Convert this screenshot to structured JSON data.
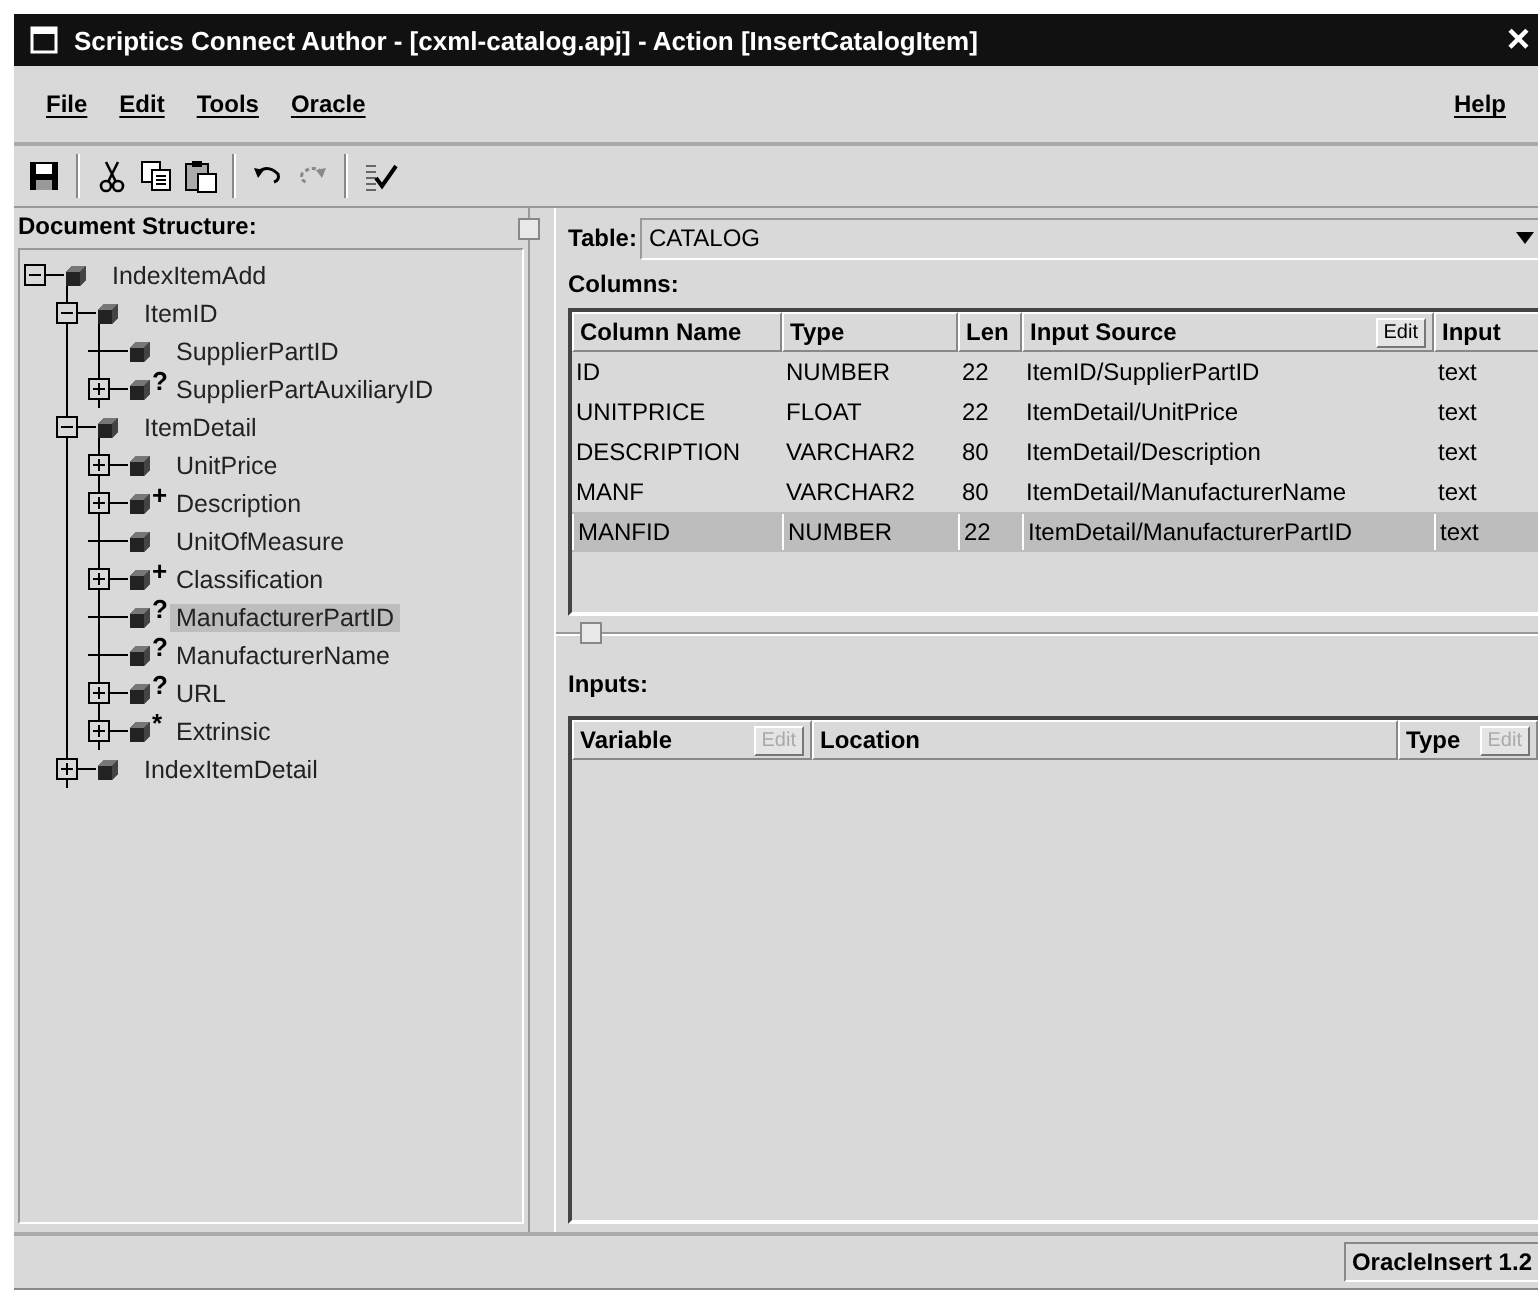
{
  "window": {
    "title": "Scriptics Connect Author - [cxml-catalog.apj] - Action [InsertCatalogItem]",
    "close": "×"
  },
  "menu": {
    "left": [
      "File",
      "Edit",
      "Tools",
      "Oracle"
    ],
    "right": [
      "Help"
    ]
  },
  "toolbar": [
    {
      "kind": "save",
      "disabled": false
    },
    {
      "kind": "sep"
    },
    {
      "kind": "cut",
      "disabled": false
    },
    {
      "kind": "copy",
      "disabled": false
    },
    {
      "kind": "paste",
      "disabled": false
    },
    {
      "kind": "sep"
    },
    {
      "kind": "undo",
      "disabled": false
    },
    {
      "kind": "redo",
      "disabled": true
    },
    {
      "kind": "sep"
    },
    {
      "kind": "check",
      "disabled": false
    }
  ],
  "document_structure": {
    "title": "Document Structure:",
    "tree": [
      {
        "label": "IndexItemAdd",
        "expanded": true,
        "selected": false,
        "children": [
          {
            "label": "ItemID",
            "expanded": true,
            "selected": false,
            "children": [
              {
                "label": "SupplierPartID",
                "selected": false
              },
              {
                "label": "SupplierPartAuxiliaryID",
                "marker": "?",
                "expanded": false,
                "selected": false
              }
            ]
          },
          {
            "label": "ItemDetail",
            "expanded": true,
            "selected": false,
            "children": [
              {
                "label": "UnitPrice",
                "expanded": false,
                "selected": false
              },
              {
                "label": "Description",
                "marker": "+",
                "expanded": false,
                "selected": false
              },
              {
                "label": "UnitOfMeasure",
                "selected": false
              },
              {
                "label": "Classification",
                "marker": "+",
                "expanded": false,
                "selected": false
              },
              {
                "label": "ManufacturerPartID",
                "marker": "?",
                "selected": true
              },
              {
                "label": "ManufacturerName",
                "marker": "?",
                "selected": false
              },
              {
                "label": "URL",
                "marker": "?",
                "expanded": false,
                "selected": false
              },
              {
                "label": "Extrinsic",
                "marker": "*",
                "expanded": false,
                "selected": false
              }
            ]
          },
          {
            "label": "IndexItemDetail",
            "expanded": false,
            "selected": false
          }
        ]
      }
    ]
  },
  "table_selector": {
    "label": "Table:",
    "value": "CATALOG"
  },
  "columns": {
    "title": "Columns:",
    "headers": [
      {
        "label": "Column Name"
      },
      {
        "label": "Type"
      },
      {
        "label": "Len"
      },
      {
        "label": "Input Source",
        "edit": {
          "label": "Edit",
          "disabled": false
        }
      },
      {
        "label": "Input"
      }
    ],
    "rows": [
      {
        "cells": [
          "ID",
          "NUMBER",
          "22",
          "ItemID/SupplierPartID",
          "text"
        ],
        "selected": false
      },
      {
        "cells": [
          "UNITPRICE",
          "FLOAT",
          "22",
          "ItemDetail/UnitPrice",
          "text"
        ],
        "selected": false
      },
      {
        "cells": [
          "DESCRIPTION",
          "VARCHAR2",
          "80",
          "ItemDetail/Description",
          "text"
        ],
        "selected": false
      },
      {
        "cells": [
          "MANF",
          "VARCHAR2",
          "80",
          "ItemDetail/ManufacturerName",
          "text"
        ],
        "selected": false
      },
      {
        "cells": [
          "MANFID",
          "NUMBER",
          "22",
          "ItemDetail/ManufacturerPartID",
          "text"
        ],
        "selected": true
      }
    ]
  },
  "inputs": {
    "title": "Inputs:",
    "headers": [
      {
        "label": "Variable",
        "edit": {
          "label": "Edit",
          "disabled": true
        }
      },
      {
        "label": "Location"
      },
      {
        "label": "Type",
        "edit": {
          "label": "Edit",
          "disabled": true
        }
      }
    ]
  },
  "status_bar": {
    "text": "OracleInsert 1.2"
  }
}
